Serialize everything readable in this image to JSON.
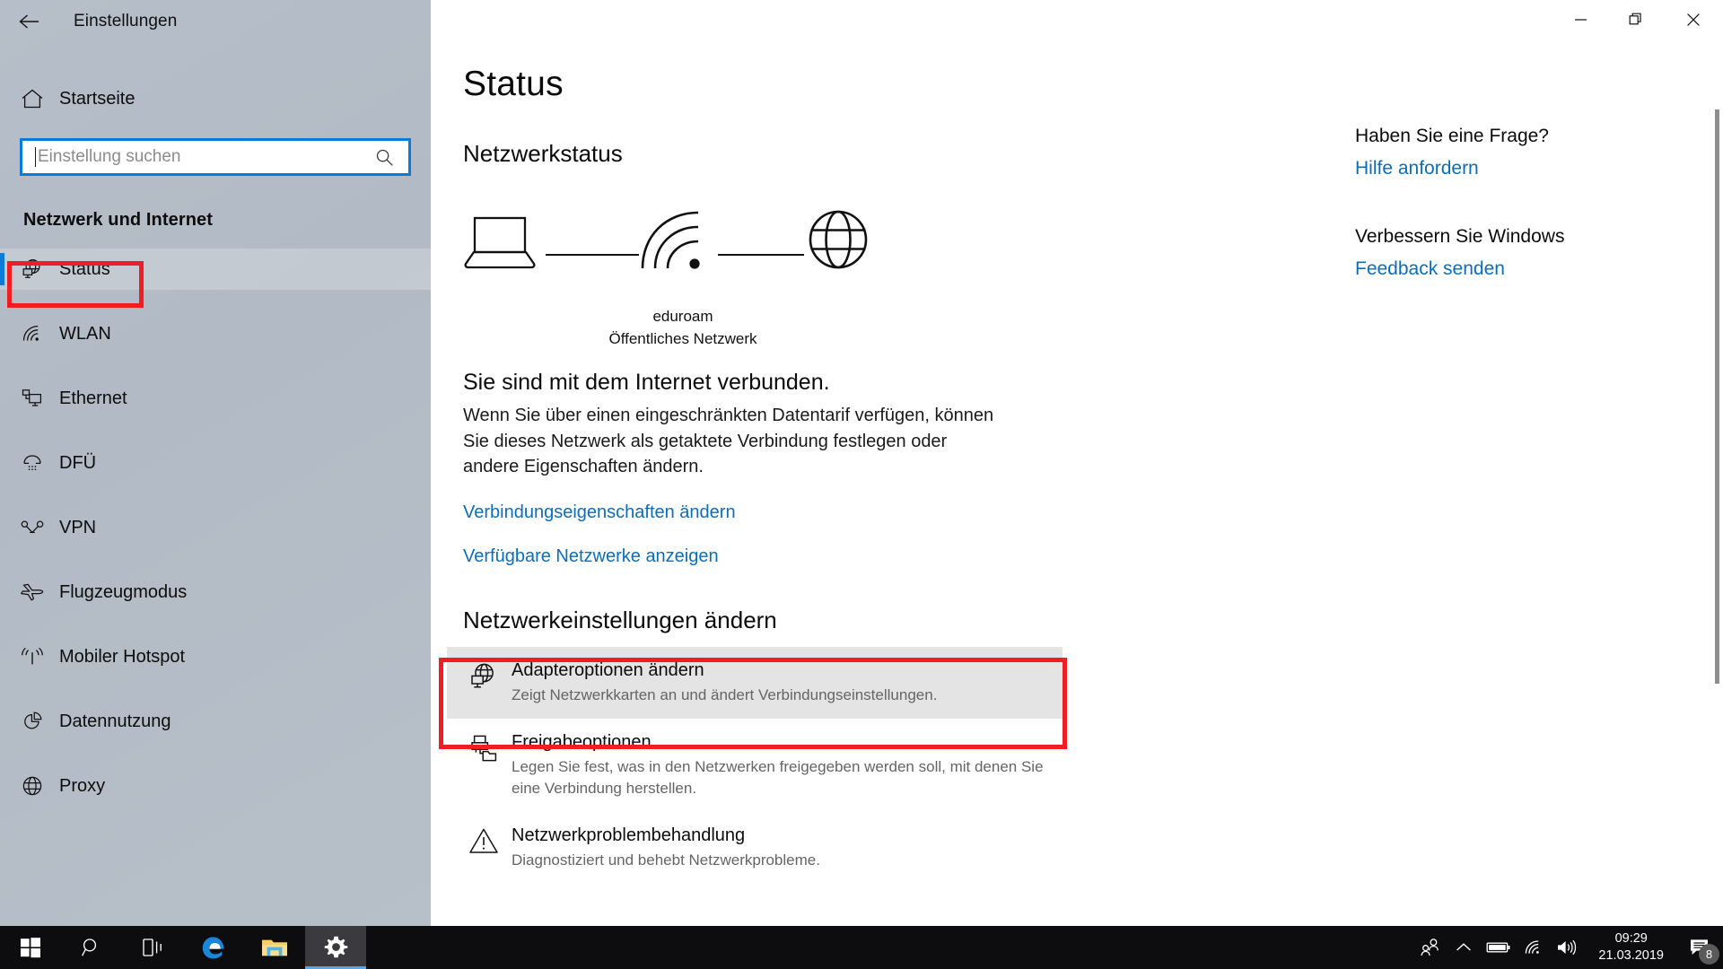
{
  "window": {
    "title": "Einstellungen",
    "back_icon": "back-arrow-icon",
    "minimize_label": "—",
    "restore_label": "❐",
    "close_label": "✕"
  },
  "sidebar": {
    "home_label": "Startseite",
    "home_icon": "home-icon",
    "search": {
      "placeholder": "Einstellung suchen",
      "value": "",
      "icon": "search-icon"
    },
    "category_title": "Netzwerk und Internet",
    "items": [
      {
        "label": "Status",
        "icon": "globe-monitor-icon",
        "selected": true
      },
      {
        "label": "WLAN",
        "icon": "wifi-icon",
        "selected": false
      },
      {
        "label": "Ethernet",
        "icon": "ethernet-icon",
        "selected": false
      },
      {
        "label": "DFÜ",
        "icon": "dialup-icon",
        "selected": false
      },
      {
        "label": "VPN",
        "icon": "vpn-icon",
        "selected": false
      },
      {
        "label": "Flugzeugmodus",
        "icon": "airplane-icon",
        "selected": false
      },
      {
        "label": "Mobiler Hotspot",
        "icon": "hotspot-icon",
        "selected": false
      },
      {
        "label": "Datennutzung",
        "icon": "pie-chart-icon",
        "selected": false
      },
      {
        "label": "Proxy",
        "icon": "globe-icon",
        "selected": false
      }
    ]
  },
  "main": {
    "page_title": "Status",
    "section_network_status": "Netzwerkstatus",
    "diagram": {
      "device_icon": "laptop-icon",
      "network_icon": "wifi-icon",
      "internet_icon": "globe-icon",
      "network_name": "eduroam",
      "network_type": "Öffentliches Netzwerk"
    },
    "connection_status": "Sie sind mit dem Internet verbunden.",
    "connection_description": "Wenn Sie über einen eingeschränkten Datentarif verfügen, können Sie dieses Netzwerk als getaktete Verbindung festlegen oder andere Eigenschaften ändern.",
    "link_connection_properties": "Verbindungseigenschaften ändern",
    "link_available_networks": "Verfügbare Netzwerke anzeigen",
    "section_change_settings": "Netzwerkeinstellungen ändern",
    "options": [
      {
        "title": "Adapteroptionen ändern",
        "subtitle": "Zeigt Netzwerkkarten an und ändert Verbindungseinstellungen.",
        "icon": "globe-monitor-icon",
        "highlighted": true
      },
      {
        "title": "Freigabeoptionen",
        "subtitle": "Legen Sie fest, was in den Netzwerken freigegeben werden soll, mit denen Sie eine Verbindung herstellen.",
        "icon": "share-folder-icon",
        "highlighted": false
      },
      {
        "title": "Netzwerkproblembehandlung",
        "subtitle": "Diagnostiziert und behebt Netzwerkprobleme.",
        "icon": "warning-triangle-icon",
        "highlighted": false
      }
    ]
  },
  "help": {
    "question_title": "Haben Sie eine Frage?",
    "question_link": "Hilfe anfordern",
    "improve_title": "Verbessern Sie Windows",
    "improve_link": "Feedback senden"
  },
  "taskbar": {
    "start_icon": "windows-start-icon",
    "search_icon": "search-icon",
    "taskview_icon": "task-view-icon",
    "edge_icon": "edge-browser-icon",
    "explorer_icon": "file-explorer-icon",
    "settings_icon": "settings-gear-icon",
    "tray": {
      "people_icon": "people-icon",
      "chevron_icon": "chevron-up-icon",
      "battery_icon": "battery-icon",
      "wifi_icon": "wifi-icon",
      "volume_icon": "speaker-icon",
      "time": "09:29",
      "date": "21.03.2019",
      "notification_icon": "notification-icon",
      "notification_count": "8"
    }
  },
  "annotations": {
    "accent_red": "#f01d22",
    "accent_blue": "#0a7bd6",
    "link_blue": "#0a6ebd"
  }
}
